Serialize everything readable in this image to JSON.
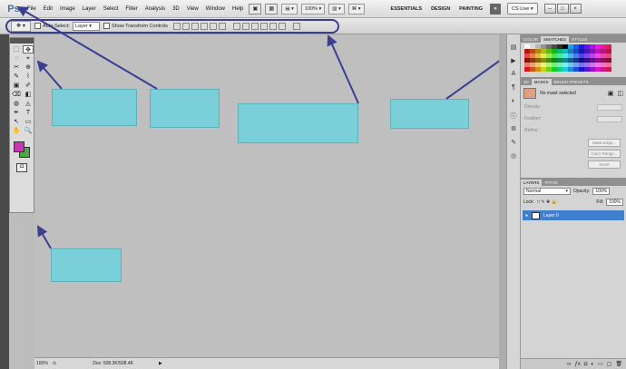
{
  "app": {
    "logo": "Ps"
  },
  "menubar": {
    "items": [
      "File",
      "Edit",
      "Image",
      "Layer",
      "Select",
      "Filter",
      "Analysis",
      "3D",
      "View",
      "Window",
      "Help"
    ],
    "zoom": "100%",
    "workspaces": [
      "ESSENTIALS",
      "DESIGN",
      "PAINTING"
    ],
    "ws_more": "»",
    "cslive": "CS Live",
    "window_controls": [
      "–",
      "□",
      "×"
    ]
  },
  "options": {
    "auto_select_label": "Auto-Select:",
    "auto_select_value": "Layer",
    "transform_label": "Show Transform Controls"
  },
  "tools": [
    "⬚",
    "✥",
    "◌",
    "⌖",
    "✂",
    "⊕",
    "✎",
    "⌇",
    "▣",
    "✐",
    "⌫",
    "◧",
    "◍",
    "◬",
    "✒",
    "T",
    "↖",
    "▭",
    "✋",
    "🔍"
  ],
  "panels": {
    "top_tabs": [
      "COLOR",
      "SWATCHES",
      "STYLES"
    ],
    "mid_tabs": [
      "3D",
      "MASKS",
      "BRUSH PRESETS"
    ],
    "mask_label": "No mask selected",
    "props": [
      "Density:",
      "Feather:"
    ],
    "refine_label": "Refine:",
    "refine_buttons": [
      "Mask Edge...",
      "Color Range...",
      "Invert"
    ],
    "layer_tabs": [
      "LAYERS",
      "PATHS"
    ],
    "blend_mode": "Normal",
    "opacity_label": "Opacity:",
    "opacity": "100%",
    "lock_label": "Lock:",
    "fill_label": "Fill:",
    "fill": "100%",
    "layer_name": "Layer 0"
  },
  "status": {
    "zoom": "100%",
    "doc": "Doc: 508.3K/508.4K"
  },
  "colors": {
    "foreground": "#c737b0",
    "background": "#4aa84a",
    "callout": "#7bcfd8",
    "leader": "#3b3f8f"
  }
}
